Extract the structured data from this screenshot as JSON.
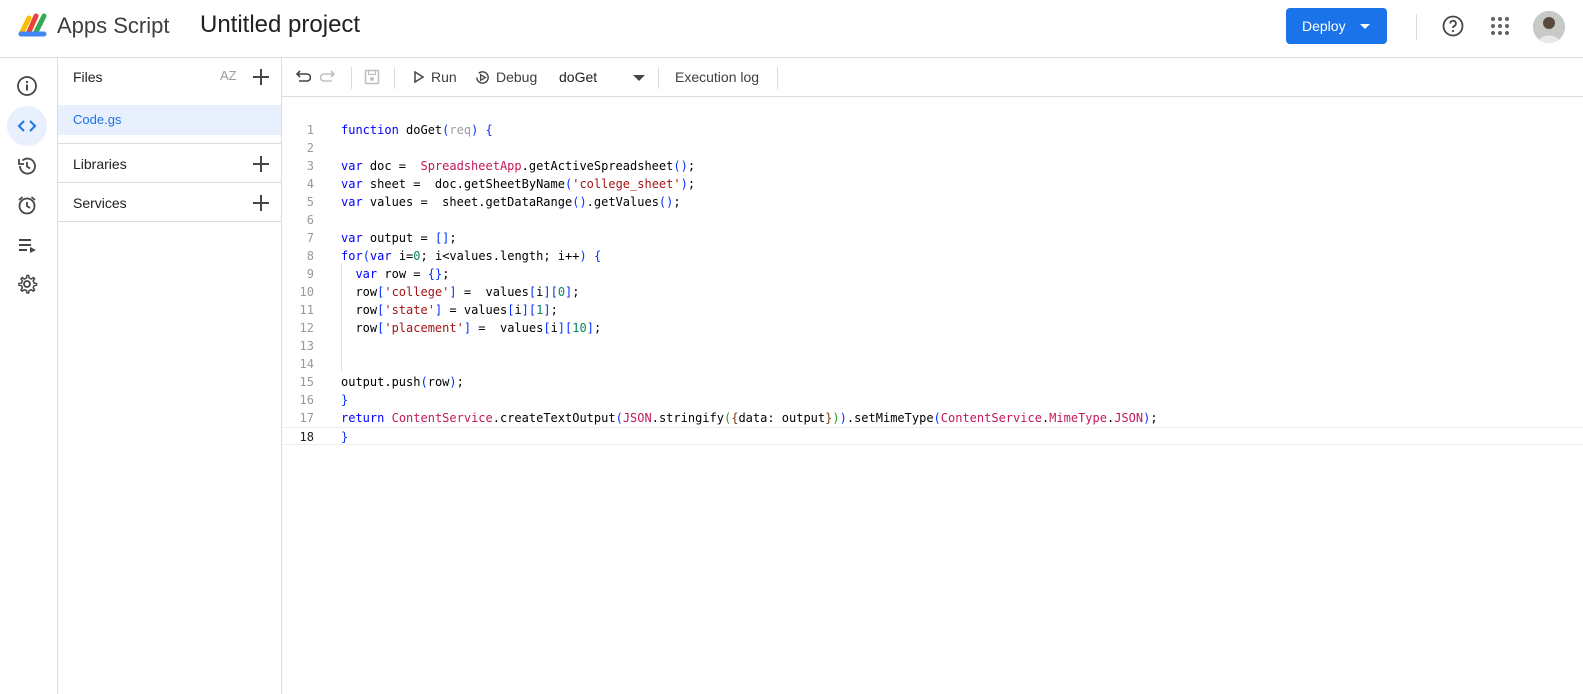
{
  "header": {
    "app_name": "Apps Script",
    "project_title": "Untitled project",
    "deploy_label": "Deploy"
  },
  "rail": {
    "items": [
      "overview-icon",
      "editor-icon",
      "history-icon",
      "triggers-icon",
      "executions-icon",
      "settings-icon"
    ],
    "active": "editor-icon"
  },
  "files_panel": {
    "title": "Files",
    "sort_label": "AZ",
    "files": [
      {
        "name": "Code.gs",
        "selected": true
      }
    ],
    "sections": [
      {
        "label": "Libraries"
      },
      {
        "label": "Services"
      }
    ]
  },
  "toolbar": {
    "run_label": "Run",
    "debug_label": "Debug",
    "function_selected": "doGet",
    "execution_log_label": "Execution log"
  },
  "editor": {
    "current_line": 18,
    "lines": [
      {
        "n": "1",
        "code": "function doGet(req) {"
      },
      {
        "n": "2",
        "code": ""
      },
      {
        "n": "3",
        "code": "var doc =  SpreadsheetApp.getActiveSpreadsheet();"
      },
      {
        "n": "4",
        "code": "var sheet =  doc.getSheetByName('college_sheet');"
      },
      {
        "n": "5",
        "code": "var values =  sheet.getDataRange().getValues();"
      },
      {
        "n": "6",
        "code": ""
      },
      {
        "n": "7",
        "code": "var output = [];"
      },
      {
        "n": "8",
        "code": "for(var i=0; i<values.length; i++) {"
      },
      {
        "n": "9",
        "code": "  var row = {};"
      },
      {
        "n": "10",
        "code": "  row['college'] =  values[i][0];"
      },
      {
        "n": "11",
        "code": "  row['state'] = values[i][1];"
      },
      {
        "n": "12",
        "code": "  row['placement'] =  values[i][10];"
      },
      {
        "n": "13",
        "code": ""
      },
      {
        "n": "14",
        "code": ""
      },
      {
        "n": "15",
        "code": "output.push(row);"
      },
      {
        "n": "16",
        "code": "}"
      },
      {
        "n": "17",
        "code": "return ContentService.createTextOutput(JSON.stringify({data: output})).setMimeType(ContentService.MimeType.JSON);"
      },
      {
        "n": "18",
        "code": "}"
      }
    ]
  },
  "colors": {
    "accent": "#1a73e8",
    "keyword": "#0000ff",
    "class_name": "#c2185b",
    "string": "#a31515",
    "number": "#098658"
  }
}
